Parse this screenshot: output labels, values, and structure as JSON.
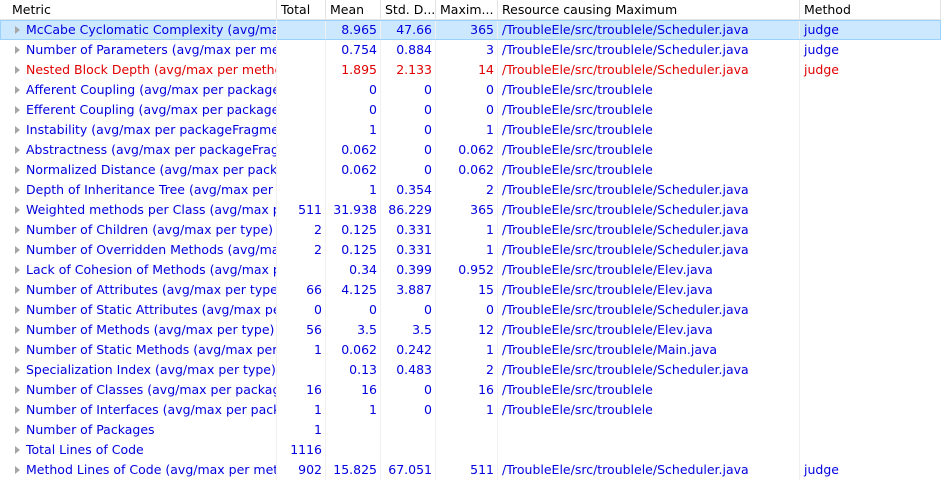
{
  "columns": {
    "metric": "Metric",
    "total": "Total",
    "mean": "Mean",
    "std": "Std. D...",
    "max": "Maxim...",
    "resource": "Resource causing Maximum",
    "method": "Method"
  },
  "colors": {
    "normal": "#0000e0",
    "warning": "#e00000",
    "selected_bg": "#cce8ff"
  },
  "rows": [
    {
      "metric": "McCabe Cyclomatic Complexity (avg/max per method)",
      "total": "",
      "mean": "8.965",
      "std": "47.66",
      "max": "365",
      "resource": "/TroubleEle/src/troublele/Scheduler.java",
      "method": "judge",
      "expandable": true,
      "selected": true,
      "warn": false
    },
    {
      "metric": "Number of Parameters (avg/max per method)",
      "total": "",
      "mean": "0.754",
      "std": "0.884",
      "max": "3",
      "resource": "/TroubleEle/src/troublele/Scheduler.java",
      "method": "judge",
      "expandable": true,
      "selected": false,
      "warn": false
    },
    {
      "metric": "Nested Block Depth (avg/max per method)",
      "total": "",
      "mean": "1.895",
      "std": "2.133",
      "max": "14",
      "resource": "/TroubleEle/src/troublele/Scheduler.java",
      "method": "judge",
      "expandable": true,
      "selected": false,
      "warn": true
    },
    {
      "metric": "Afferent Coupling (avg/max per packageFragment)",
      "total": "",
      "mean": "0",
      "std": "0",
      "max": "0",
      "resource": "/TroubleEle/src/troublele",
      "method": "",
      "expandable": true,
      "selected": false,
      "warn": false
    },
    {
      "metric": "Efferent Coupling (avg/max per packageFragment)",
      "total": "",
      "mean": "0",
      "std": "0",
      "max": "0",
      "resource": "/TroubleEle/src/troublele",
      "method": "",
      "expandable": true,
      "selected": false,
      "warn": false
    },
    {
      "metric": "Instability (avg/max per packageFragment)",
      "total": "",
      "mean": "1",
      "std": "0",
      "max": "1",
      "resource": "/TroubleEle/src/troublele",
      "method": "",
      "expandable": true,
      "selected": false,
      "warn": false
    },
    {
      "metric": "Abstractness (avg/max per packageFragment)",
      "total": "",
      "mean": "0.062",
      "std": "0",
      "max": "0.062",
      "resource": "/TroubleEle/src/troublele",
      "method": "",
      "expandable": true,
      "selected": false,
      "warn": false
    },
    {
      "metric": "Normalized Distance (avg/max per packageFragment)",
      "total": "",
      "mean": "0.062",
      "std": "0",
      "max": "0.062",
      "resource": "/TroubleEle/src/troublele",
      "method": "",
      "expandable": true,
      "selected": false,
      "warn": false
    },
    {
      "metric": "Depth of Inheritance Tree (avg/max per type)",
      "total": "",
      "mean": "1",
      "std": "0.354",
      "max": "2",
      "resource": "/TroubleEle/src/troublele/Scheduler.java",
      "method": "",
      "expandable": true,
      "selected": false,
      "warn": false
    },
    {
      "metric": "Weighted methods per Class (avg/max per type)",
      "total": "511",
      "mean": "31.938",
      "std": "86.229",
      "max": "365",
      "resource": "/TroubleEle/src/troublele/Scheduler.java",
      "method": "",
      "expandable": true,
      "selected": false,
      "warn": false
    },
    {
      "metric": "Number of Children (avg/max per type)",
      "total": "2",
      "mean": "0.125",
      "std": "0.331",
      "max": "1",
      "resource": "/TroubleEle/src/troublele/Scheduler.java",
      "method": "",
      "expandable": true,
      "selected": false,
      "warn": false
    },
    {
      "metric": "Number of Overridden Methods (avg/max per type)",
      "total": "2",
      "mean": "0.125",
      "std": "0.331",
      "max": "1",
      "resource": "/TroubleEle/src/troublele/Scheduler.java",
      "method": "",
      "expandable": true,
      "selected": false,
      "warn": false
    },
    {
      "metric": "Lack of Cohesion of Methods (avg/max per type)",
      "total": "",
      "mean": "0.34",
      "std": "0.399",
      "max": "0.952",
      "resource": "/TroubleEle/src/troublele/Elev.java",
      "method": "",
      "expandable": true,
      "selected": false,
      "warn": false
    },
    {
      "metric": "Number of Attributes (avg/max per type)",
      "total": "66",
      "mean": "4.125",
      "std": "3.887",
      "max": "15",
      "resource": "/TroubleEle/src/troublele/Elev.java",
      "method": "",
      "expandable": true,
      "selected": false,
      "warn": false
    },
    {
      "metric": "Number of Static Attributes (avg/max per type)",
      "total": "0",
      "mean": "0",
      "std": "0",
      "max": "0",
      "resource": "/TroubleEle/src/troublele/Scheduler.java",
      "method": "",
      "expandable": true,
      "selected": false,
      "warn": false
    },
    {
      "metric": "Number of Methods (avg/max per type)",
      "total": "56",
      "mean": "3.5",
      "std": "3.5",
      "max": "12",
      "resource": "/TroubleEle/src/troublele/Elev.java",
      "method": "",
      "expandable": true,
      "selected": false,
      "warn": false
    },
    {
      "metric": "Number of Static Methods (avg/max per type)",
      "total": "1",
      "mean": "0.062",
      "std": "0.242",
      "max": "1",
      "resource": "/TroubleEle/src/troublele/Main.java",
      "method": "",
      "expandable": true,
      "selected": false,
      "warn": false
    },
    {
      "metric": "Specialization Index (avg/max per type)",
      "total": "",
      "mean": "0.13",
      "std": "0.483",
      "max": "2",
      "resource": "/TroubleEle/src/troublele/Scheduler.java",
      "method": "",
      "expandable": true,
      "selected": false,
      "warn": false
    },
    {
      "metric": "Number of Classes (avg/max per packageFragment)",
      "total": "16",
      "mean": "16",
      "std": "0",
      "max": "16",
      "resource": "/TroubleEle/src/troublele",
      "method": "",
      "expandable": true,
      "selected": false,
      "warn": false
    },
    {
      "metric": "Number of Interfaces (avg/max per packageFragment)",
      "total": "1",
      "mean": "1",
      "std": "0",
      "max": "1",
      "resource": "/TroubleEle/src/troublele",
      "method": "",
      "expandable": true,
      "selected": false,
      "warn": false
    },
    {
      "metric": "Number of Packages",
      "total": "1",
      "mean": "",
      "std": "",
      "max": "",
      "resource": "",
      "method": "",
      "expandable": true,
      "selected": false,
      "warn": false
    },
    {
      "metric": "Total Lines of Code",
      "total": "1116",
      "mean": "",
      "std": "",
      "max": "",
      "resource": "",
      "method": "",
      "expandable": true,
      "selected": false,
      "warn": false
    },
    {
      "metric": "Method Lines of Code (avg/max per method)",
      "total": "902",
      "mean": "15.825",
      "std": "67.051",
      "max": "511",
      "resource": "/TroubleEle/src/troublele/Scheduler.java",
      "method": "judge",
      "expandable": true,
      "selected": false,
      "warn": false
    }
  ]
}
